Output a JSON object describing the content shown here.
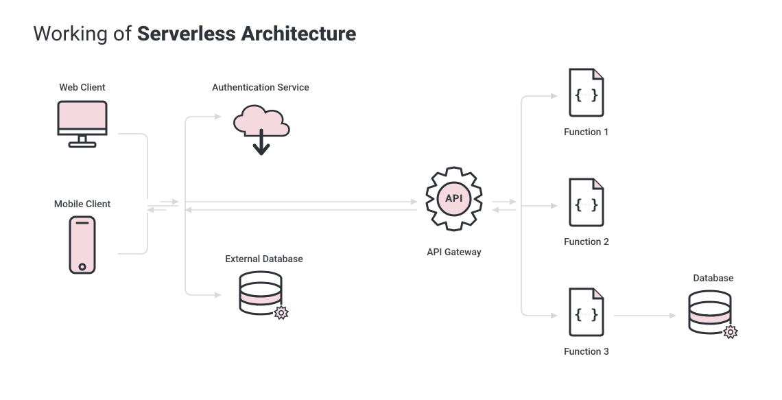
{
  "title_prefix": "Working of ",
  "title_bold": "Serverless Architecture",
  "nodes": {
    "webclient": "Web Client",
    "mobileclient": "Mobile Client",
    "auth": "Authentication Service",
    "extdb": "External Database",
    "gateway_label": "API Gateway",
    "gateway_badge": "API",
    "fn1": "Function 1",
    "fn2": "Function 2",
    "fn3": "Function 3",
    "db": "Database"
  },
  "colors": {
    "stroke": "#2d3239",
    "line": "#d9d9dd",
    "pink": "#f6d9df",
    "pink_text": "#e8a4b3"
  }
}
